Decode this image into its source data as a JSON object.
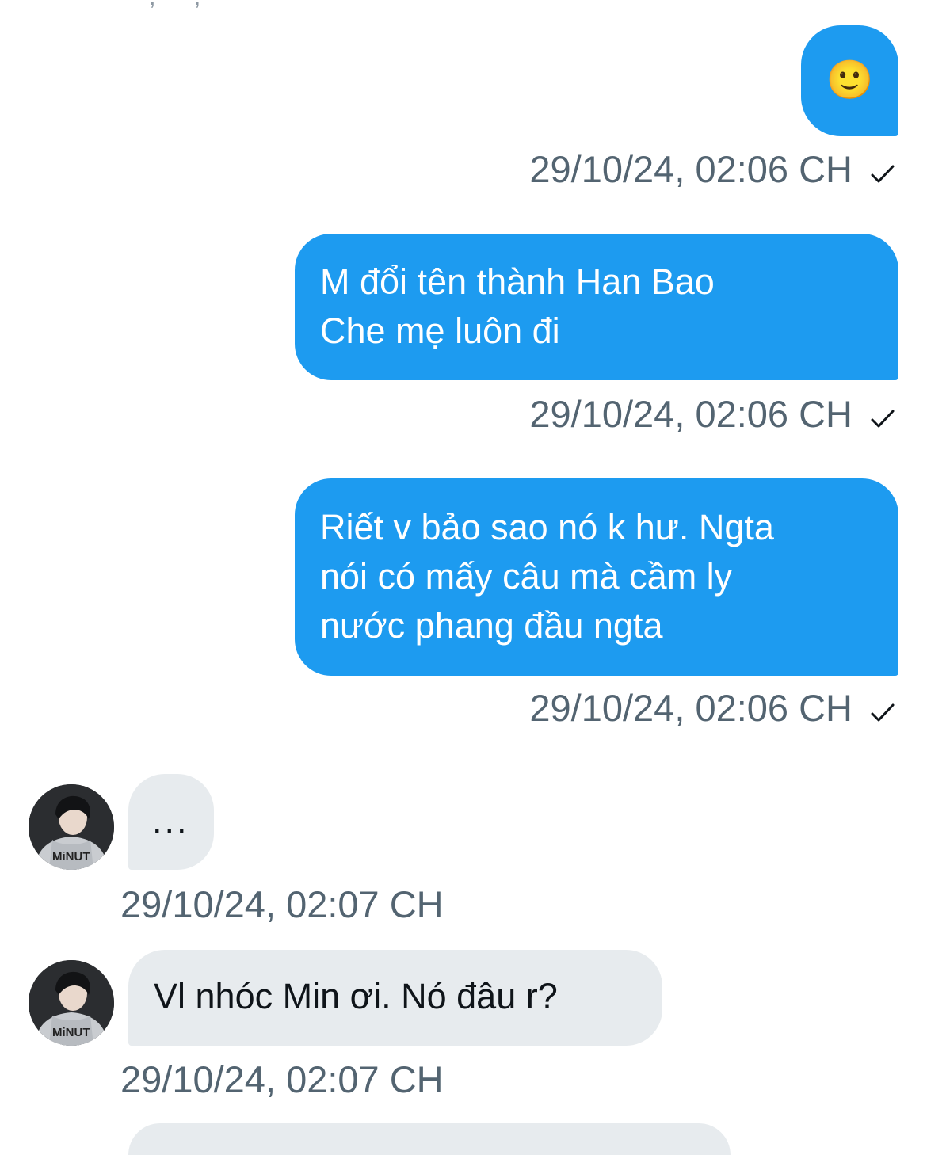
{
  "cut_off_text": "' , ' ' , '",
  "messages": [
    {
      "id": "m1",
      "direction": "out",
      "text": "🙂",
      "timestamp": "29/10/24, 02:06 CH"
    },
    {
      "id": "m2",
      "direction": "out",
      "lines": [
        "M đổi tên thành Han Bao",
        "Che mẹ luôn đi"
      ],
      "timestamp": "29/10/24, 02:06 CH"
    },
    {
      "id": "m3",
      "direction": "out",
      "lines": [
        "Riết v bảo sao nó k hư. Ngta",
        "nói có mấy câu mà cầm ly",
        "nước phang đầu ngta"
      ],
      "timestamp": "29/10/24, 02:06 CH"
    },
    {
      "id": "m4",
      "direction": "in",
      "text": "...",
      "timestamp": "29/10/24, 02:07 CH"
    },
    {
      "id": "m5",
      "direction": "in",
      "text": "Vl nhóc Min ơi. Nó đâu r?",
      "timestamp": "29/10/24, 02:07 CH"
    }
  ],
  "icons": {
    "sent_check": "checkmark-icon",
    "avatar": "user-avatar"
  },
  "colors": {
    "outgoing_bubble": "#1d9bf0",
    "incoming_bubble": "#e7ebee",
    "timestamp": "#536471",
    "incoming_text": "#0f1419"
  }
}
